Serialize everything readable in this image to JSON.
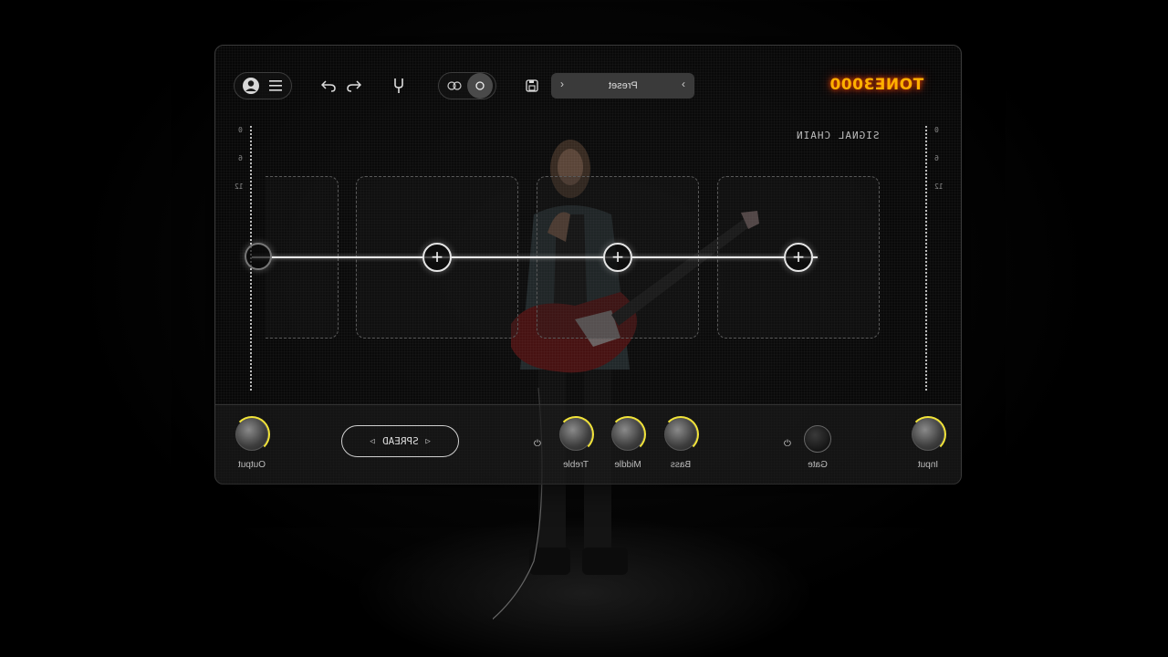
{
  "app": {
    "logo_text": "TONE3000"
  },
  "toolbar": {
    "preset_label": "Preset",
    "prev_arrow": "‹",
    "next_arrow": "›",
    "menu_icon": "hamburger-icon",
    "account_icon": "user-circle-icon",
    "undo_icon": "undo-icon",
    "redo_icon": "redo-icon",
    "tuner_icon": "tuning-fork-icon",
    "save_icon": "save-icon"
  },
  "signal_chain": {
    "title": "SIGNAL CHAIN",
    "meter_ticks": [
      "0",
      "6",
      "12"
    ],
    "slots": [
      {
        "add_label": "+"
      },
      {
        "add_label": "+"
      },
      {
        "add_label": "+"
      }
    ]
  },
  "controls": {
    "output_label": "Output",
    "spread_label": "SPREAD",
    "treble_label": "Treble",
    "middle_label": "Middle",
    "bass_label": "Bass",
    "gate_label": "Gate",
    "input_label": "Input",
    "power_icon": "power-icon"
  },
  "colors": {
    "accent_arc": "#f2e43a",
    "logo": "#ffb000",
    "logo_glow": "#ff4a00"
  }
}
